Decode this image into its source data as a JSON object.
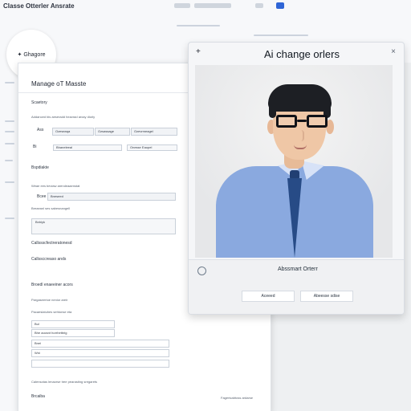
{
  "topbar": {
    "title": "Classe Otterler Ansrate"
  },
  "lens": {
    "label": "Ghagore",
    "icon": "pin-icon"
  },
  "form": {
    "heading": "Manage oT Masste",
    "section_security": "Scaetory",
    "desc_1": "Addanced bis aeseradd heavrad arxay diorly",
    "desc_1_value": "",
    "selector_label": "Ass",
    "selector_opt1": "Ozeseaqa",
    "selector_opt2": "Ozsassage",
    "selector_opt3": "Ozevrmeagel",
    "field_label_1": "Bi",
    "field_value_1": "Bhaneleeal",
    "field_value_2": "Onesse Eaopel",
    "section_specials": "Bspdiakte",
    "desc_2": "Weae ees beviaw arendeaaenstat",
    "field_label_3": "Bcee",
    "field_value_3": "Bneseed",
    "desc_3": "Breaeanl ses sabesnangell",
    "box_text": "Bnhiyk",
    "section_5": "Callssscfectreratonesd",
    "section_6": "Callssccreaso ands",
    "section_7": "Broedl enaeeiner acors",
    "desc_7": "Pargaseertoe nenior areir",
    "desc_8": "Pacaeslatuhes sehtonse eta",
    "field_value_8": "Bul",
    "field_value_9": "Bhe aocsnt horrhetbrig",
    "field_value_10": "Bnei",
    "field_value_11": "Wni",
    "footer_desc": "Calensotas lenaorse tree pearasting sregarets",
    "footer_label": "Brcaiba",
    "footer_right": "Fagertcabtoss ardarse"
  },
  "modal": {
    "title": "Ai change orlers",
    "caption": "Abssmart Orterr",
    "btn_left": "Aceeed",
    "btn_right": "Abeesse sdise"
  }
}
